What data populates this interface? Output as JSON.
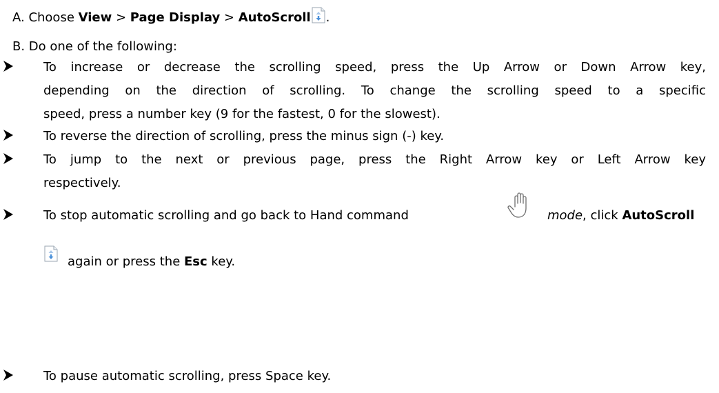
{
  "step_a": {
    "prefix": "A. Choose ",
    "menu_view": "View",
    "sep1": " > ",
    "menu_page_display": "Page Display",
    "sep2": " > ",
    "menu_autoscroll": "AutoScroll",
    "suffix": "."
  },
  "step_b": {
    "text": "B. Do one of the following:"
  },
  "bullets": {
    "b1_line1": "To increase or decrease the scrolling speed, press the Up Arrow or Down Arrow key,",
    "b1_line2": "depending on the direction of scrolling. To change the scrolling speed to a specific",
    "b1_line3": "speed, press a number key (9 for the fastest, 0 for the slowest).",
    "b2_line1": "To reverse the direction of scrolling, press the minus sign (-) key.",
    "b3_line1": "To jump to the next or previous page, press the Right Arrow key or Left Arrow key",
    "b3_line2": "respectively.",
    "b4_part1": "To stop automatic scrolling and go back to Hand command",
    "b4_mode": "mode",
    "b4_part2": ", click ",
    "b4_autoscroll": "AutoScroll",
    "b4_line2_pre": "again or press the ",
    "b4_esc": "Esc",
    "b4_line2_post": " key.",
    "b5_line1": "To pause automatic scrolling, press Space key."
  },
  "icons": {
    "bullet": "arrowhead-bullet-icon",
    "autoscroll": "autoscroll-icon",
    "hand": "hand-icon"
  },
  "colors": {
    "text": "#000000",
    "icon_blue": "#4a90d9",
    "icon_border": "#9aa6b2"
  }
}
